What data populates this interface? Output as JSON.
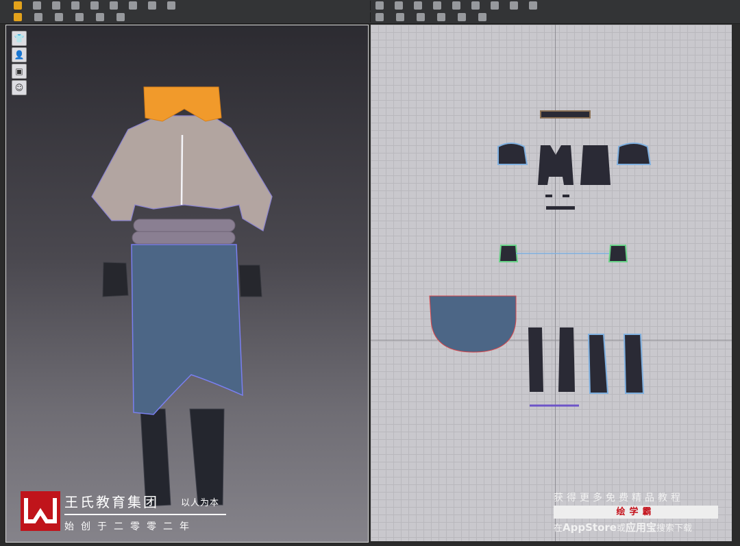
{
  "toolbar": {
    "row1_icons": [
      "pointer-icon",
      "move-icon",
      "select-icon",
      "transform-icon",
      "edit-icon",
      "sewing-icon",
      "fold-icon",
      "pin-icon",
      "trace-icon",
      "arrow-icon",
      "seam-icon",
      "rect-icon",
      "poly-icon",
      "circle-icon",
      "internal-icon",
      "notch-icon",
      "dart-icon",
      "layout-icon"
    ],
    "row2_icons": [
      "simulate-icon",
      "pose-icon",
      "tack-icon",
      "measure-icon",
      "avatar-icon",
      "fabric-icon",
      "button-icon",
      "zipper-icon",
      "topstitch-icon",
      "texture-icon",
      "grading-icon",
      "arrange-icon"
    ]
  },
  "viewport3d": {
    "tools": [
      {
        "name": "garment-display-icon",
        "glyph": "👕"
      },
      {
        "name": "avatar-display-icon",
        "glyph": "👤"
      },
      {
        "name": "texture-display-icon",
        "glyph": "▣"
      },
      {
        "name": "skin-display-icon",
        "glyph": "☺"
      }
    ]
  },
  "branding": {
    "name": "王氏教育集团",
    "motto": "以人为本",
    "since": "始创于二零零二年"
  },
  "promo": {
    "line1": "获得更多免费精品教程",
    "app": "绘学霸",
    "line3_pre": "在",
    "line3_store": "AppStore",
    "line3_mid": "或",
    "line3_yyb": "应用宝",
    "line3_post": "搜索下载"
  },
  "colors": {
    "accent": "#e3a21b",
    "brand_red": "#c0141b",
    "shirt": "#b9aba6",
    "skirt": "#4c6686",
    "pants": "#24262e",
    "collar": "#f19a2b",
    "belt": "#8a7f92",
    "pattern_piece": "#2a2a35",
    "pattern_outline": "#7fb0e0"
  }
}
